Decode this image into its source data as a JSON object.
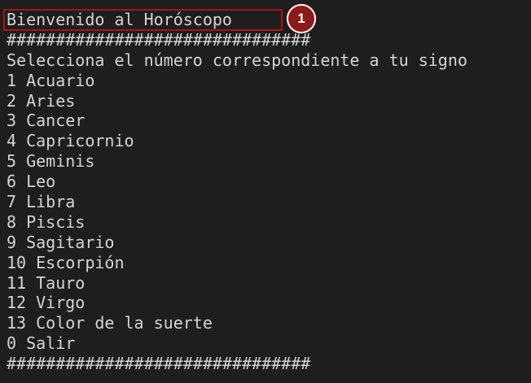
{
  "terminal": {
    "title_line": "Bienvenido al Horóscopo",
    "separator_top": "###############################",
    "prompt_line": "Selecciona el número correspondiente a tu signo",
    "options": [
      "1 Acuario",
      "2 Aries",
      "3 Cancer",
      "4 Capricornio",
      "5 Geminis",
      "6 Leo",
      "7 Libra",
      "8 Piscis",
      "9 Sagitario",
      "10 Escorpión",
      "11 Tauro",
      "12 Virgo",
      "13 Color de la suerte",
      "0 Salir"
    ],
    "separator_bottom": "###############################"
  },
  "annotation": {
    "step_number": "1",
    "box_color": "#a31515",
    "badge_color": "#8b1a1a"
  },
  "colors": {
    "background": "#1e1e1e",
    "text": "#d4d4d4"
  }
}
